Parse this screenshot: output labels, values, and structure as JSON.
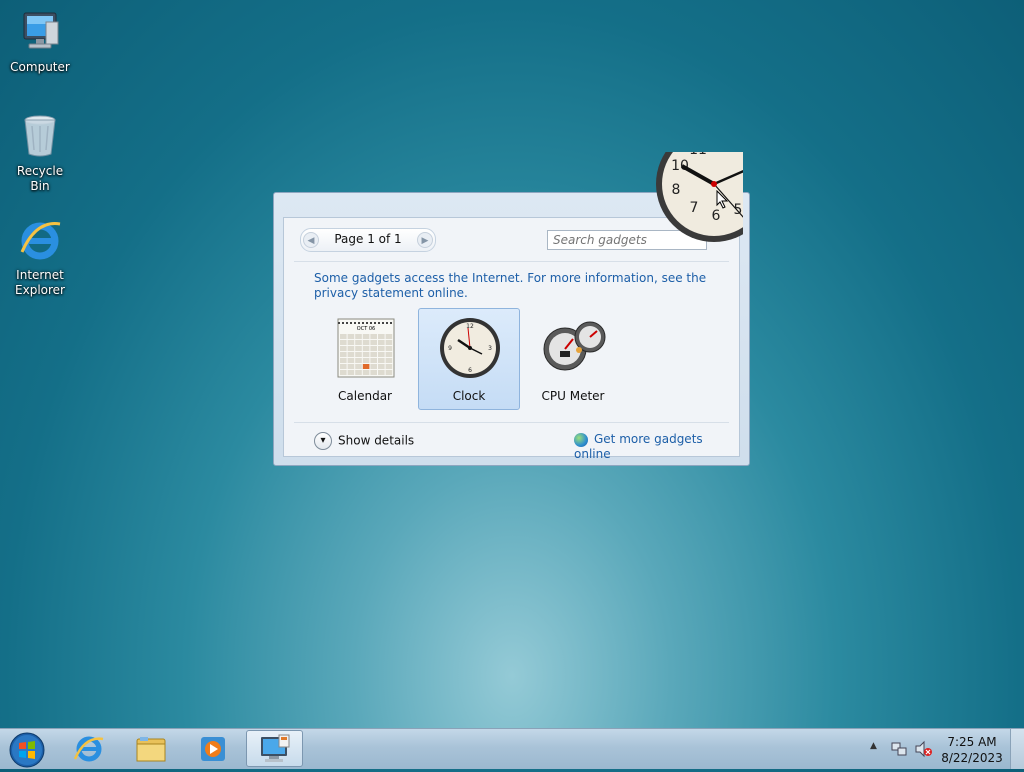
{
  "desktop": {
    "icons": [
      {
        "label": "Computer"
      },
      {
        "label": "Recycle Bin"
      },
      {
        "label": "Internet Explorer"
      }
    ]
  },
  "gadget_gallery": {
    "pager_label": "Page 1 of 1",
    "search_placeholder": "Search gadgets",
    "notice": "Some gadgets access the Internet.  For more information, see the privacy statement online.",
    "gadgets": [
      {
        "name": "Calendar",
        "selected": false,
        "month": "OCT 06"
      },
      {
        "name": "Clock",
        "selected": true
      },
      {
        "name": "CPU Meter",
        "selected": false
      }
    ],
    "show_details_label": "Show details",
    "get_more_label": "Get more gadgets online"
  },
  "taskbar": {
    "pinned": [
      {
        "icon": "internet-explorer-icon",
        "active": false
      },
      {
        "icon": "file-explorer-icon",
        "active": false
      },
      {
        "icon": "media-player-icon",
        "active": false
      },
      {
        "icon": "gadgets-icon",
        "active": true
      }
    ],
    "time": "7:25 AM",
    "date": "8/22/2023"
  },
  "colors": {
    "link": "#1d5fa8",
    "selection": "#c5dcf5"
  }
}
